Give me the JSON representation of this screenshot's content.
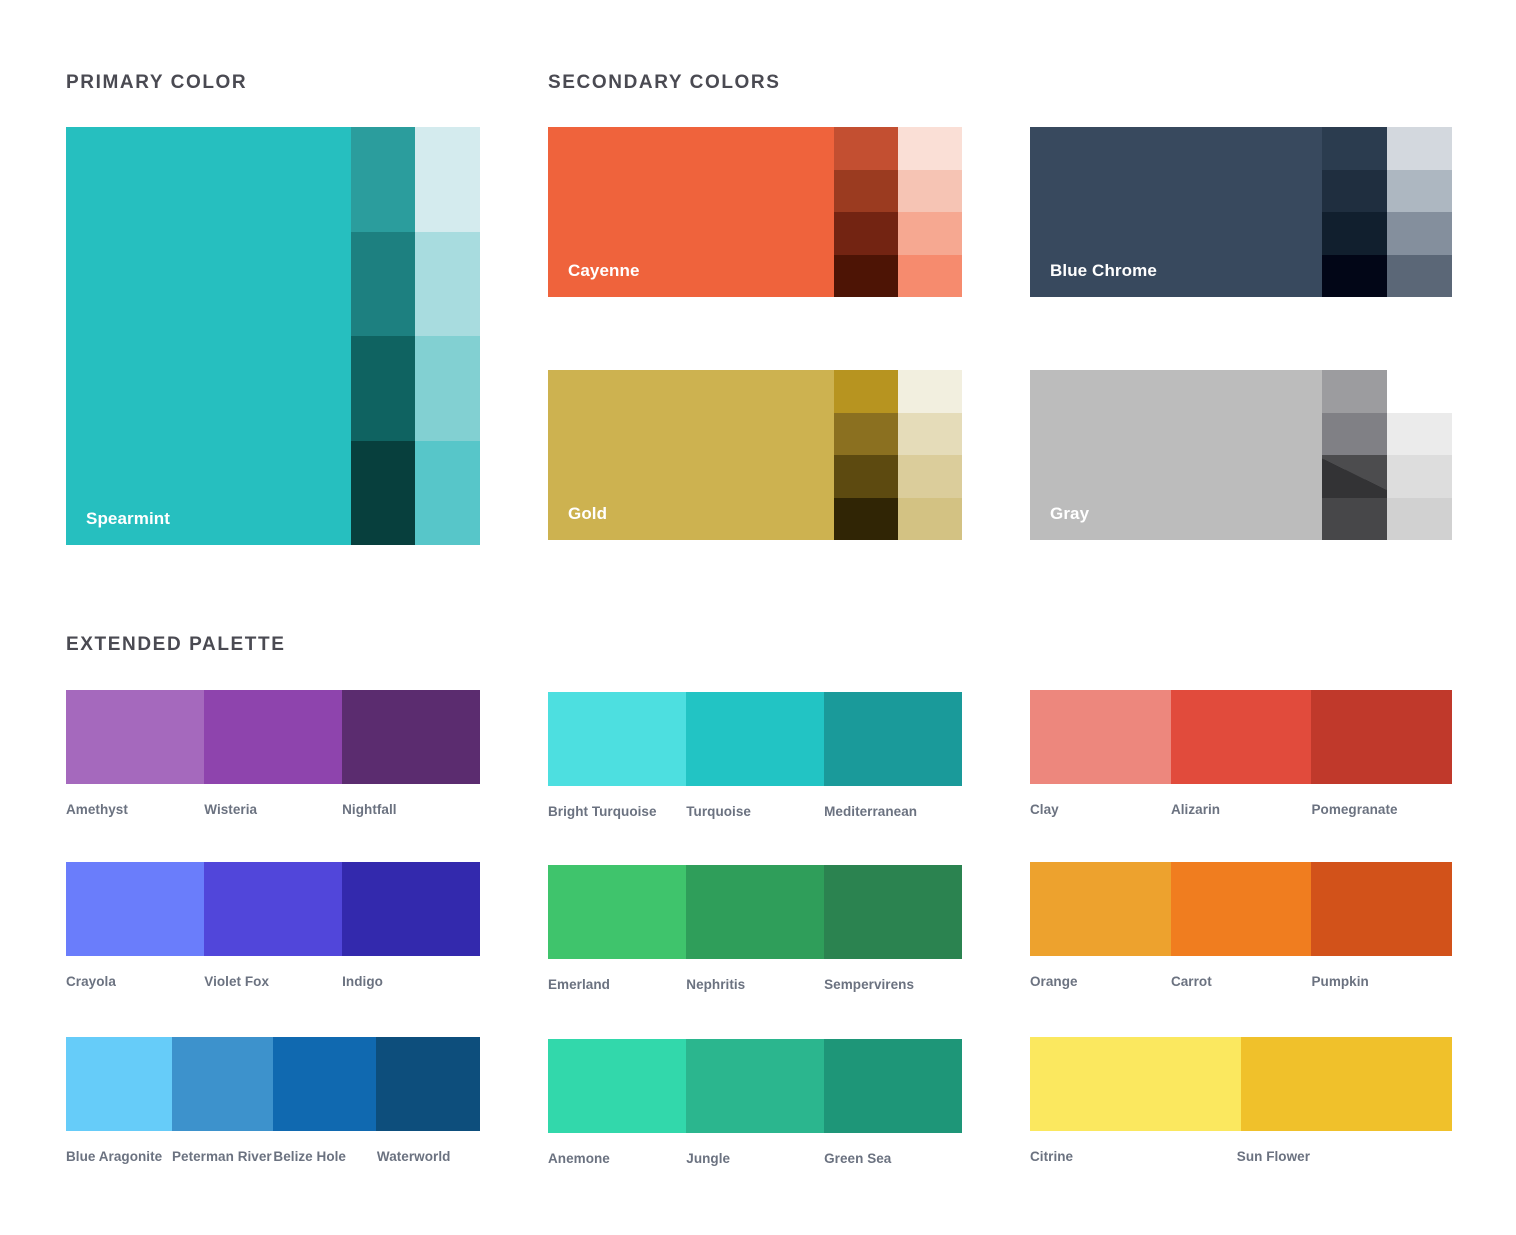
{
  "sections": {
    "primary": {
      "title": "PRIMARY COLOR"
    },
    "secondary": {
      "title": "SECONDARY COLORS"
    },
    "extended": {
      "title": "EXTENDED PALETTE"
    }
  },
  "primary_block": {
    "name": "Spearmint",
    "base": "#26bfbf",
    "dark_ramp": [
      "#2b9d9d",
      "#1d8080",
      "#0f6361",
      "#073f3d"
    ],
    "light_ramp": [
      "#d4ebee",
      "#a8dcdf",
      "#82d0d2",
      "#57c6c9"
    ]
  },
  "secondary_blocks": [
    {
      "name": "Cayenne",
      "base": "#ef633c",
      "dark_ramp": [
        "#c34f31",
        "#9b3b20",
        "#732412",
        "#4d1405"
      ],
      "light_ramp": [
        "#fadfd6",
        "#f6c4b4",
        "#f6a891",
        "#f68b6e"
      ]
    },
    {
      "name": "Blue Chrome",
      "base": "#38495e",
      "dark_ramp": [
        "#2b3c4f",
        "#1f2e3f",
        "#111f2e",
        "#020617"
      ],
      "light_ramp": [
        "#d3d8de",
        "#adb7c1",
        "#848f9d",
        "#5b6777"
      ]
    },
    {
      "name": "Gold",
      "base": "#cdb250",
      "dark_ramp": [
        "#b79420",
        "#8b7020",
        "#5d4a10",
        "#302505"
      ],
      "light_ramp": [
        "#f2efdf",
        "#e5dcb9",
        "#dbcd9b",
        "#d3c283"
      ]
    },
    {
      "name": "Gray",
      "base": "#bcbcbc",
      "dark_ramp": [
        "#9c9c9f",
        "#808085",
        "#636368",
        "#474749"
      ],
      "light_ramp": [
        "#ffffff",
        "#ebebeb",
        "#dddddd",
        "#d1d1d1"
      ]
    }
  ],
  "extended_groups": [
    {
      "id": "purples",
      "swatches": [
        {
          "name": "Amethyst",
          "hex": "#a569bd",
          "width_pct": 33.4
        },
        {
          "name": "Wisteria",
          "hex": "#8e44ad",
          "width_pct": 33.3
        },
        {
          "name": "Nightfall",
          "hex": "#5b2c6f",
          "width_pct": 33.3
        }
      ],
      "label_offsets_pct": [
        0.0,
        33.4,
        66.7
      ]
    },
    {
      "id": "turquoises",
      "swatches": [
        {
          "name": "Bright Turquoise",
          "hex": "#4ddfe0",
          "width_pct": 33.4
        },
        {
          "name": "Turquoise",
          "hex": "#22c4c4",
          "width_pct": 33.3
        },
        {
          "name": "Mediterranean",
          "hex": "#1a9a9a",
          "width_pct": 33.3
        }
      ],
      "label_offsets_pct": [
        0.0,
        33.4,
        66.7
      ]
    },
    {
      "id": "reds",
      "swatches": [
        {
          "name": "Clay",
          "hex": "#ed877d",
          "width_pct": 33.4
        },
        {
          "name": "Alizarin",
          "hex": "#e14b3c",
          "width_pct": 33.3
        },
        {
          "name": "Pomegranate",
          "hex": "#c0392b",
          "width_pct": 33.3
        }
      ],
      "label_offsets_pct": [
        0.0,
        33.4,
        66.7
      ]
    },
    {
      "id": "blues-violet",
      "swatches": [
        {
          "name": "Crayola",
          "hex": "#6a7dfb",
          "width_pct": 33.4
        },
        {
          "name": "Violet Fox",
          "hex": "#5146da",
          "width_pct": 33.3
        },
        {
          "name": "Indigo",
          "hex": "#3329ad",
          "width_pct": 33.3
        }
      ],
      "label_offsets_pct": [
        0.0,
        33.4,
        66.7
      ]
    },
    {
      "id": "greens",
      "swatches": [
        {
          "name": "Emerland",
          "hex": "#3fc46c",
          "width_pct": 33.4
        },
        {
          "name": "Nephritis",
          "hex": "#2f9e5a",
          "width_pct": 33.3
        },
        {
          "name": "Sempervirens",
          "hex": "#2b8350",
          "width_pct": 33.3
        }
      ],
      "label_offsets_pct": [
        0.0,
        33.4,
        66.7
      ]
    },
    {
      "id": "oranges",
      "swatches": [
        {
          "name": "Orange",
          "hex": "#eda22e",
          "width_pct": 33.4
        },
        {
          "name": "Carrot",
          "hex": "#f07d1f",
          "width_pct": 33.3
        },
        {
          "name": "Pumpkin",
          "hex": "#d2521a",
          "width_pct": 33.3
        }
      ],
      "label_offsets_pct": [
        0.0,
        33.4,
        66.7
      ]
    },
    {
      "id": "ocean-blues",
      "swatches": [
        {
          "name": "Blue Aragonite",
          "hex": "#66ccf9",
          "width_pct": 25.6
        },
        {
          "name": "Peterman River",
          "hex": "#3d92cc",
          "width_pct": 24.5
        },
        {
          "name": "Belize Hole",
          "hex": "#1069b0",
          "width_pct": 24.9
        },
        {
          "name": "Waterworld",
          "hex": "#0d4e7c",
          "width_pct": 25.0
        }
      ],
      "label_offsets_pct": [
        0.0,
        25.6,
        50.1,
        75.1
      ]
    },
    {
      "id": "sea-greens",
      "swatches": [
        {
          "name": "Anemone",
          "hex": "#32d8ab",
          "width_pct": 33.4
        },
        {
          "name": "Jungle",
          "hex": "#2bb68e",
          "width_pct": 33.3
        },
        {
          "name": "Green Sea",
          "hex": "#1e9678",
          "width_pct": 33.3
        }
      ],
      "label_offsets_pct": [
        0.0,
        33.4,
        66.7
      ]
    },
    {
      "id": "yellows",
      "swatches": [
        {
          "name": "Citrine",
          "hex": "#fbe85f",
          "width_pct": 50.0
        },
        {
          "name": "Sun Flower",
          "hex": "#f0c12b",
          "width_pct": 50.0
        }
      ],
      "label_offsets_pct": [
        0.0,
        49.0
      ]
    }
  ]
}
